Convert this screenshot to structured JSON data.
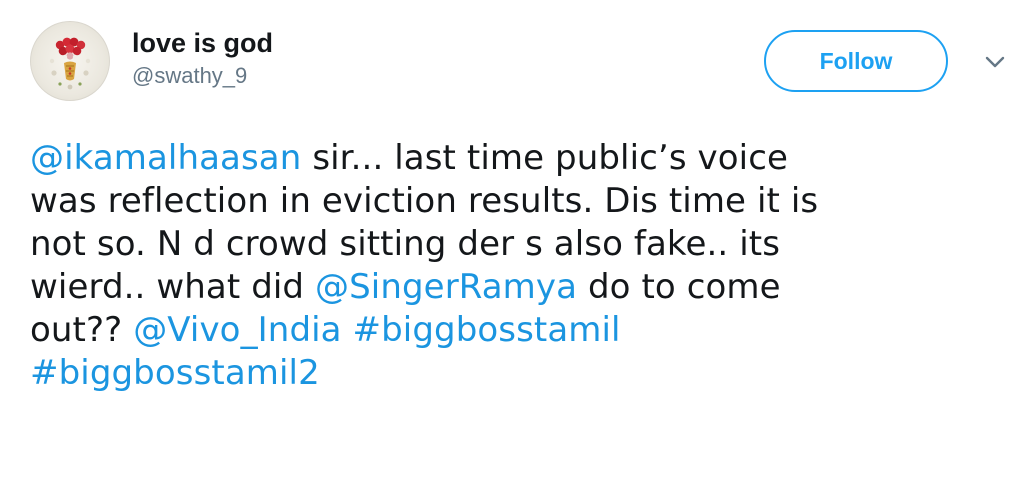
{
  "user": {
    "display_name": "love is god",
    "handle": "@swathy_9",
    "avatar_icon": "flower-art-avatar"
  },
  "actions": {
    "follow_label": "Follow",
    "more_icon": "chevron-down-icon"
  },
  "colors": {
    "link": "#1b95e0",
    "follow_border": "#1da1f2",
    "handle": "#657786",
    "text": "#14171a"
  },
  "tweet": {
    "lines": [
      [
        {
          "type": "mention",
          "text": "@ikamalhaasan"
        },
        {
          "type": "text",
          "text": " sir... last time public’s voice"
        }
      ],
      [
        {
          "type": "text",
          "text": "was reflection in eviction results. Dis time it is"
        }
      ],
      [
        {
          "type": "text",
          "text": "not so. N d crowd sitting der s also fake.. its"
        }
      ],
      [
        {
          "type": "text",
          "text": "wierd.. what did "
        },
        {
          "type": "mention",
          "text": "@SingerRamya"
        },
        {
          "type": "text",
          "text": " do to come"
        }
      ],
      [
        {
          "type": "text",
          "text": "out?? "
        },
        {
          "type": "mention",
          "text": "@Vivo_India"
        },
        {
          "type": "text",
          "text": " "
        },
        {
          "type": "hashtag",
          "text": "#biggbosstamil"
        }
      ],
      [
        {
          "type": "hashtag",
          "text": "#biggbosstamil2"
        }
      ]
    ]
  }
}
